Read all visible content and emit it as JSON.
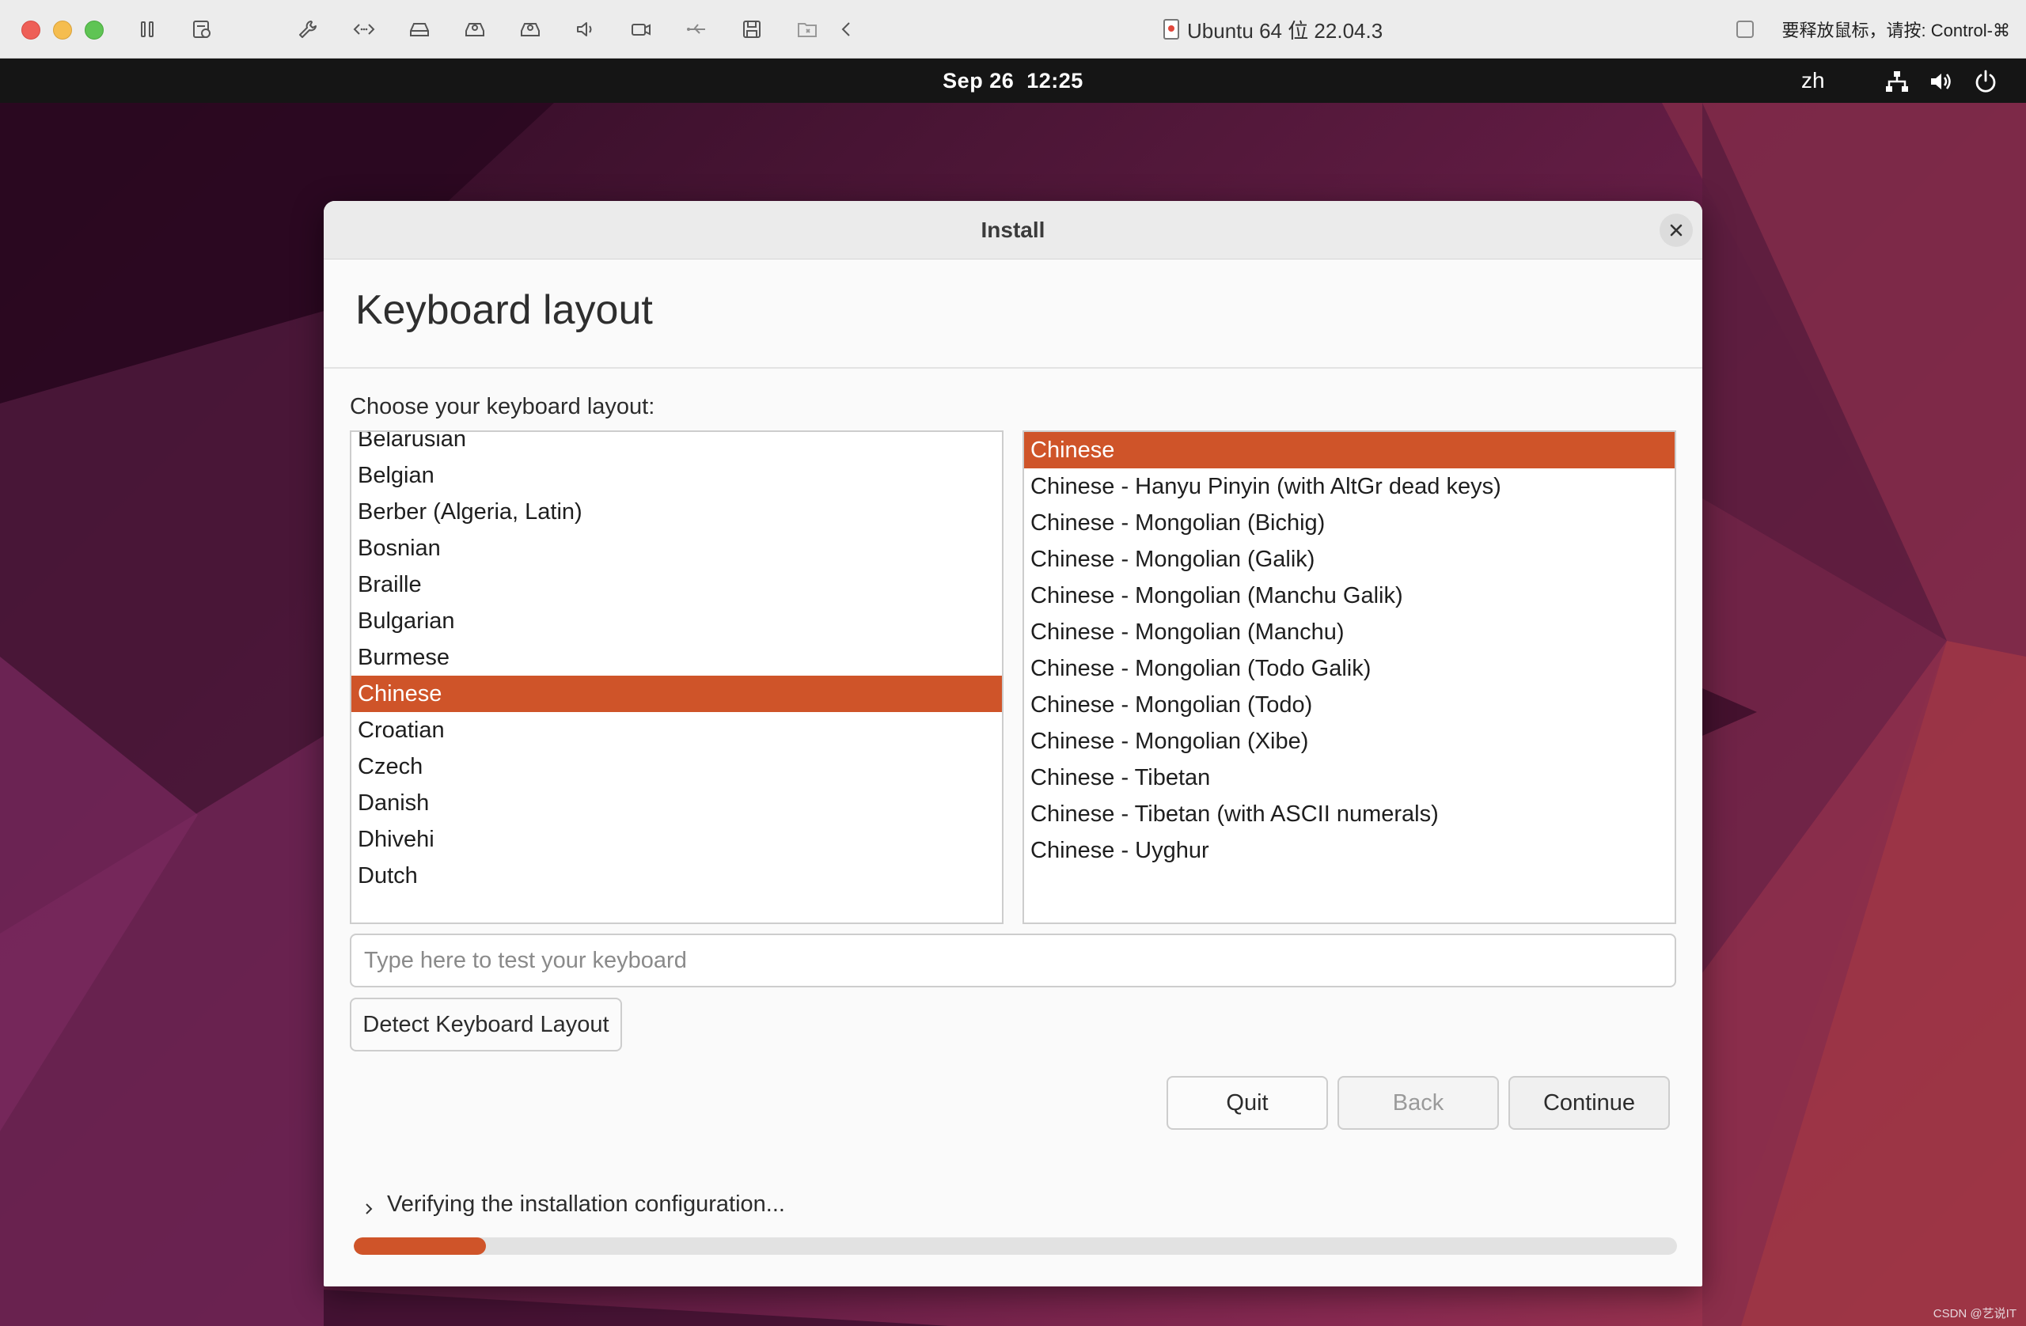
{
  "vm": {
    "window_title": "Ubuntu 64 位 22.04.3",
    "release_hint": "要释放鼠标，请按: Control-⌘",
    "toolbar_icons": [
      "pause-icon",
      "snapshot-icon",
      "wrench-icon",
      "code-icon",
      "hard-disk-icon",
      "optical-drive-icon",
      "disk-icon",
      "sound-icon",
      "camera-icon",
      "usb-icon",
      "floppy-icon",
      "shared-folder-icon",
      "chevron-left-icon"
    ]
  },
  "topbar": {
    "date": "Sep 26",
    "time": "12:25",
    "language": "zh"
  },
  "dialog": {
    "title": "Install",
    "page_title": "Keyboard layout",
    "choose_label": "Choose your keyboard layout:",
    "layouts": [
      "Belarusian",
      "Belgian",
      "Berber (Algeria, Latin)",
      "Bosnian",
      "Braille",
      "Bulgarian",
      "Burmese",
      "Chinese",
      "Croatian",
      "Czech",
      "Danish",
      "Dhivehi",
      "Dutch"
    ],
    "selected_layout": "Chinese",
    "variants": [
      "Chinese",
      "Chinese - Hanyu Pinyin (with AltGr dead keys)",
      "Chinese - Mongolian (Bichig)",
      "Chinese - Mongolian (Galik)",
      "Chinese - Mongolian (Manchu Galik)",
      "Chinese - Mongolian (Manchu)",
      "Chinese - Mongolian (Todo Galik)",
      "Chinese - Mongolian (Todo)",
      "Chinese - Mongolian (Xibe)",
      "Chinese - Tibetan",
      "Chinese - Tibetan (with ASCII numerals)",
      "Chinese - Uyghur"
    ],
    "selected_variant": "Chinese",
    "test_placeholder": "Type here to test your keyboard",
    "test_value": "",
    "detect_label": "Detect Keyboard Layout",
    "quit_label": "Quit",
    "back_label": "Back",
    "continue_label": "Continue",
    "status_text": "Verifying the installation configuration...",
    "progress_fraction": 0.1
  },
  "colors": {
    "accent": "#cf5429",
    "dialog_bg": "#fafafa",
    "topbar_bg": "#151515"
  },
  "watermark": "CSDN @艺说IT"
}
